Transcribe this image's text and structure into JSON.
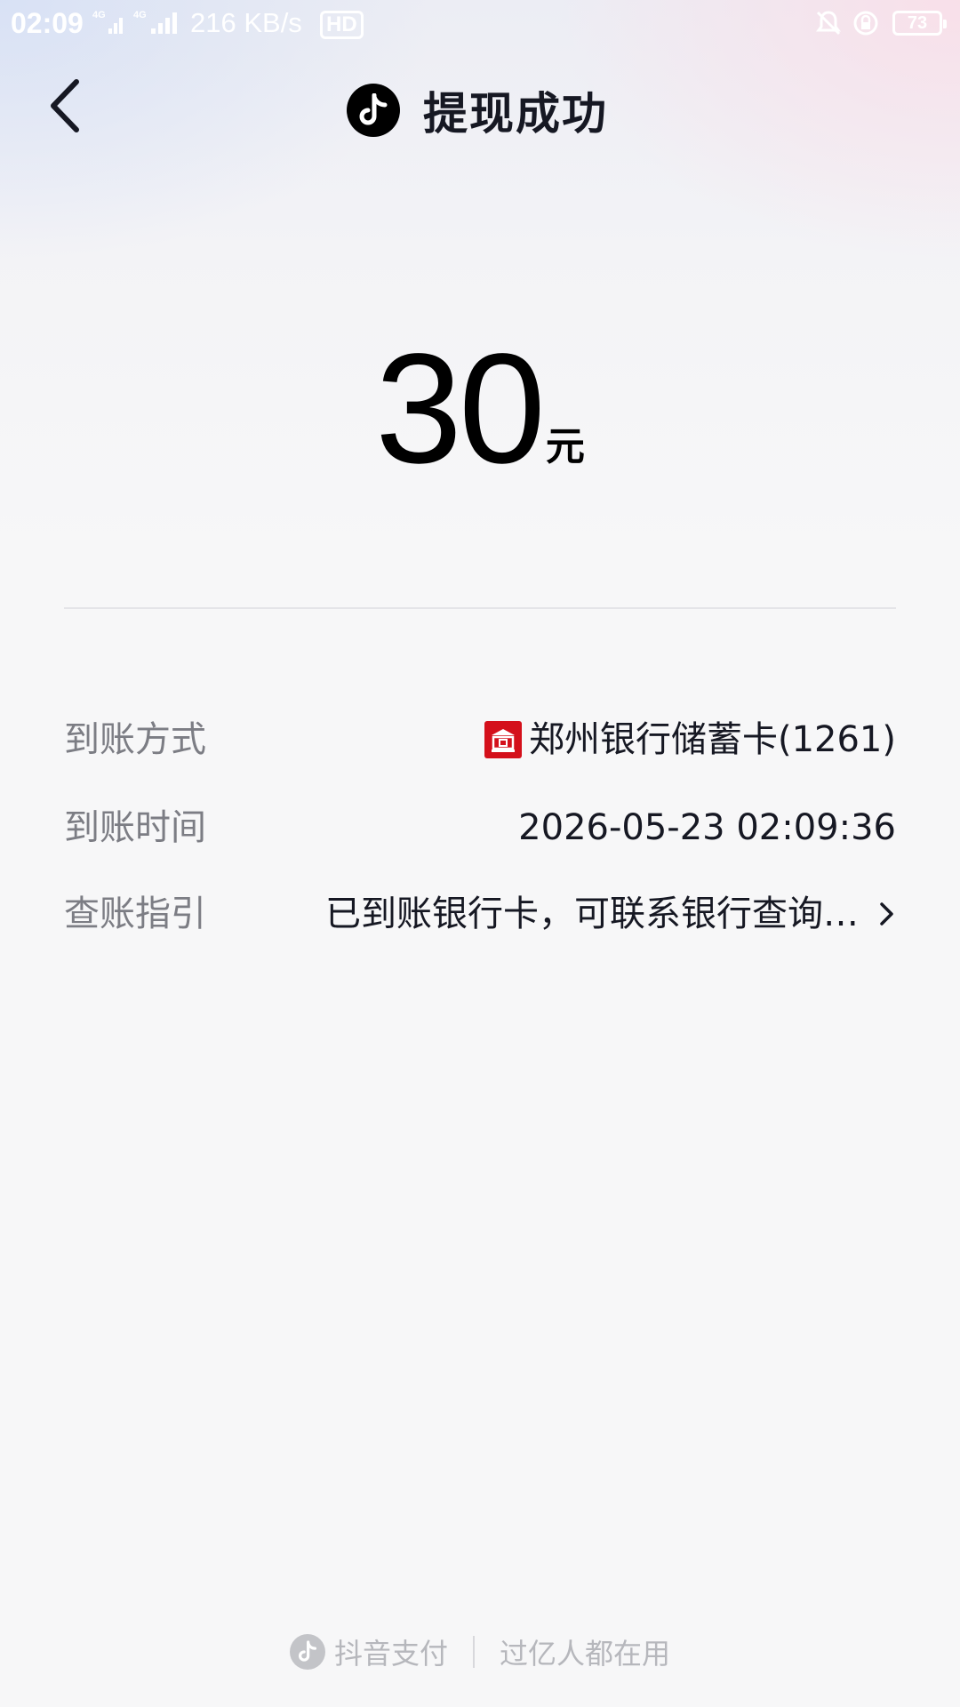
{
  "status_bar": {
    "time": "02:09",
    "network_speed": "216 KB/s",
    "hd_label": "HD",
    "battery_level": "73",
    "icons": [
      "4g-signal-icon",
      "4g-signal-icon",
      "silent-bell-icon",
      "rotation-lock-icon",
      "battery-icon"
    ]
  },
  "header": {
    "title": "提现成功",
    "logo": "tiktok-logo-icon",
    "back_icon": "chevron-left-icon"
  },
  "amount": {
    "value": "30",
    "unit": "元"
  },
  "details": [
    {
      "label": "到账方式",
      "value": "郑州银行储蓄卡(1261)",
      "icon": "bank-icon",
      "icon_color": "#d4101b"
    },
    {
      "label": "到账时间",
      "value": "2026-05-23 02:09:36"
    },
    {
      "label": "查账指引",
      "value": "已到账银行卡，可联系银行查询…",
      "trailing_icon": "chevron-right-icon"
    }
  ],
  "footer": {
    "brand": "抖音支付",
    "slogan": "过亿人都在用"
  },
  "colors": {
    "bank_red": "#d4101b",
    "text_primary": "#161823",
    "text_secondary": "#7c7d84",
    "footer_text": "#b6b7bc"
  }
}
